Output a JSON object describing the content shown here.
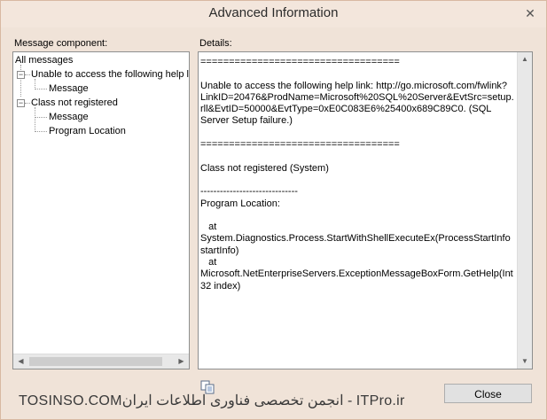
{
  "window": {
    "title": "Advanced Information",
    "close_glyph": "✕"
  },
  "labels": {
    "message_component": "Message component:",
    "details": "Details:"
  },
  "tree": {
    "root": "All messages",
    "groups": [
      {
        "label": "Unable to access the following help lin",
        "children": [
          "Message"
        ]
      },
      {
        "label": "Class not registered",
        "children": [
          "Message",
          "Program Location"
        ]
      }
    ]
  },
  "details": {
    "text": "===================================\n\nUnable to access the following help link: http://go.microsoft.com/fwlink?LinkID=20476&ProdName=Microsoft%20SQL%20Server&EvtSrc=setup.rll&EvtID=50000&EvtType=0xE0C083E6%25400x689C89C0. (SQL Server Setup failure.)\n\n===================================\n\nClass not registered (System)\n\n------------------------------\nProgram Location:\n\n   at System.Diagnostics.Process.StartWithShellExecuteEx(ProcessStartInfo startInfo)\n   at Microsoft.NetEnterpriseServers.ExceptionMessageBoxForm.GetHelp(Int32 index)"
  },
  "footer": {
    "watermark": "TOSINSO.COMانجمن تخصصی فناوری اطلاعات ایران - ITPro.ir"
  },
  "buttons": {
    "close": "Close"
  },
  "icons": {
    "copy": "copy-icon"
  }
}
